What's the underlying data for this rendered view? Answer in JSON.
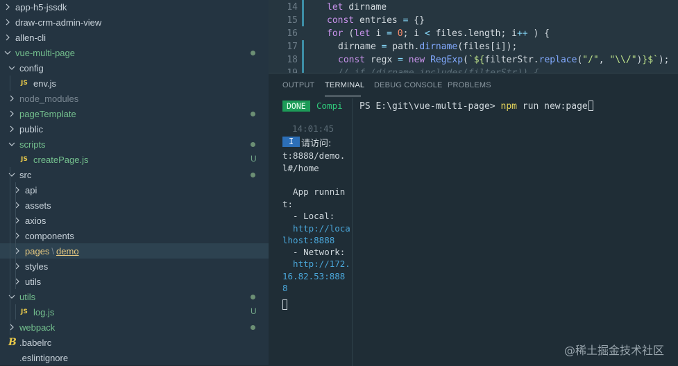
{
  "explorer": {
    "rows": [
      {
        "label": "app-h5-jssdk",
        "kind": "folder-collapsed",
        "level": 0
      },
      {
        "label": "draw-crm-admin-view",
        "kind": "folder-collapsed",
        "level": 0
      },
      {
        "label": "allen-cli",
        "kind": "folder-collapsed",
        "level": 0
      },
      {
        "label": "vue-multi-page",
        "kind": "folder-open",
        "level": 0,
        "color": "green",
        "status": "dot"
      },
      {
        "label": "config",
        "kind": "folder-open",
        "level": 1
      },
      {
        "label": "env.js",
        "kind": "js",
        "level": 2
      },
      {
        "label": "node_modules",
        "kind": "folder-collapsed",
        "level": 1,
        "color": "dim"
      },
      {
        "label": "pageTemplate",
        "kind": "folder-collapsed",
        "level": 1,
        "color": "green",
        "status": "dot"
      },
      {
        "label": "public",
        "kind": "folder-collapsed",
        "level": 1
      },
      {
        "label": "scripts",
        "kind": "folder-open",
        "level": 1,
        "color": "green",
        "status": "dot"
      },
      {
        "label": "createPage.js",
        "kind": "js",
        "level": 2,
        "color": "green",
        "status": "U"
      },
      {
        "label": "src",
        "kind": "folder-open",
        "level": 1,
        "status": "dot"
      },
      {
        "label": "api",
        "kind": "folder-collapsed",
        "level": 2
      },
      {
        "label": "assets",
        "kind": "folder-collapsed",
        "level": 2
      },
      {
        "label": "axios",
        "kind": "folder-collapsed",
        "level": 2
      },
      {
        "label": "components",
        "kind": "folder-collapsed",
        "level": 2
      },
      {
        "label": "pages",
        "label2": "demo",
        "kind": "folder-collapsed-path",
        "level": 2,
        "color": "yellow",
        "selected": true
      },
      {
        "label": "styles",
        "kind": "folder-collapsed",
        "level": 2
      },
      {
        "label": "utils",
        "kind": "folder-collapsed",
        "level": 2
      },
      {
        "label": "utils",
        "kind": "folder-open",
        "level": 1,
        "color": "green",
        "status": "dot"
      },
      {
        "label": "log.js",
        "kind": "js",
        "level": 2,
        "color": "green",
        "status": "U"
      },
      {
        "label": "webpack",
        "kind": "folder-collapsed",
        "level": 1,
        "color": "green",
        "status": "dot"
      },
      {
        "label": ".babelrc",
        "kind": "babel",
        "level": 1
      },
      {
        "label": ".eslintignore",
        "kind": "plain",
        "level": 1
      }
    ],
    "path_separator": "\\",
    "js_badge": "JS",
    "babel_badge": "B"
  },
  "editor": {
    "lines": [
      {
        "num": "14",
        "tokens": [
          [
            "kw",
            "let "
          ],
          [
            "",
            "dirname"
          ]
        ]
      },
      {
        "num": "15",
        "tokens": [
          [
            "kw",
            "const "
          ],
          [
            "",
            "entries "
          ],
          [
            "op",
            "= "
          ],
          [
            "",
            "{}"
          ]
        ]
      },
      {
        "num": "16",
        "tokens": [
          [
            "kw",
            "for "
          ],
          [
            "",
            "("
          ],
          [
            "kw",
            "let "
          ],
          [
            "",
            "i "
          ],
          [
            "op",
            "= "
          ],
          [
            "num",
            "0"
          ],
          [
            "",
            "; i "
          ],
          [
            "op",
            "< "
          ],
          [
            "",
            "files.length; i"
          ],
          [
            "op",
            "++"
          ],
          [
            "",
            " ) {"
          ]
        ]
      },
      {
        "num": "17",
        "indent": 1,
        "tokens": [
          [
            "",
            "dirname "
          ],
          [
            "op",
            "= "
          ],
          [
            "",
            "path."
          ],
          [
            "fn",
            "dirname"
          ],
          [
            "",
            "(files[i]);"
          ]
        ]
      },
      {
        "num": "18",
        "indent": 1,
        "tokens": [
          [
            "kw",
            "const "
          ],
          [
            "",
            "regx "
          ],
          [
            "op",
            "= "
          ],
          [
            "kw",
            "new "
          ],
          [
            "fn",
            "RegExp"
          ],
          [
            "",
            "("
          ],
          [
            "str",
            "`${"
          ],
          [
            "",
            "filterStr."
          ],
          [
            "fn",
            "replace"
          ],
          [
            "",
            "("
          ],
          [
            "str",
            "\"/\""
          ],
          [
            "",
            ", "
          ],
          [
            "str",
            "\"\\\\/\""
          ],
          [
            "",
            ")"
          ],
          [
            "str",
            "}$`"
          ],
          [
            "",
            ");"
          ]
        ]
      },
      {
        "num": "19",
        "indent": 1,
        "tokens": [
          [
            "cm",
            "// if (dirname.includes(filterStr)) {"
          ]
        ]
      }
    ]
  },
  "panel": {
    "tabs": [
      {
        "label": "OUTPUT",
        "active": false
      },
      {
        "label": "TERMINAL",
        "active": true
      },
      {
        "label": "DEBUG CONSOLE",
        "active": false
      },
      {
        "label": "PROBLEMS",
        "active": false
      }
    ],
    "left_terminal": {
      "done_badge": "DONE",
      "compiled_text": "Compi",
      "timestamp": "14:01:45",
      "info_badge": "I",
      "visit_text": "请访问:",
      "lines": [
        {
          "text": "t:8888/demo.",
          "style": ""
        },
        {
          "text": "l#/home",
          "style": ""
        },
        {
          "text": "  App runnin",
          "style": ""
        },
        {
          "text": "t:",
          "style": ""
        },
        {
          "text": "  - Local:",
          "style": ""
        },
        {
          "text": "  http://loca",
          "style": "blue"
        },
        {
          "text": "lhost:8888",
          "style": "blue"
        },
        {
          "text": "  - Network:",
          "style": ""
        },
        {
          "text": "  http://172.",
          "style": "blue"
        },
        {
          "text": "16.82.53:888",
          "style": "blue"
        },
        {
          "text": "8",
          "style": "blue"
        }
      ]
    },
    "right_terminal": {
      "prompt": "PS E:\\git\\vue-multi-page> ",
      "command": "npm",
      "args": " run new:page"
    }
  },
  "watermark": "@稀土掘金技术社区",
  "colors": {
    "sidebar_bg": "#243441",
    "editor_bg": "#263640",
    "panel_bg": "#1f2d36",
    "git_green": "#74c08e",
    "done_green": "#1d9b58",
    "info_blue": "#2c6fb8",
    "command_yellow": "#e5d55a"
  }
}
